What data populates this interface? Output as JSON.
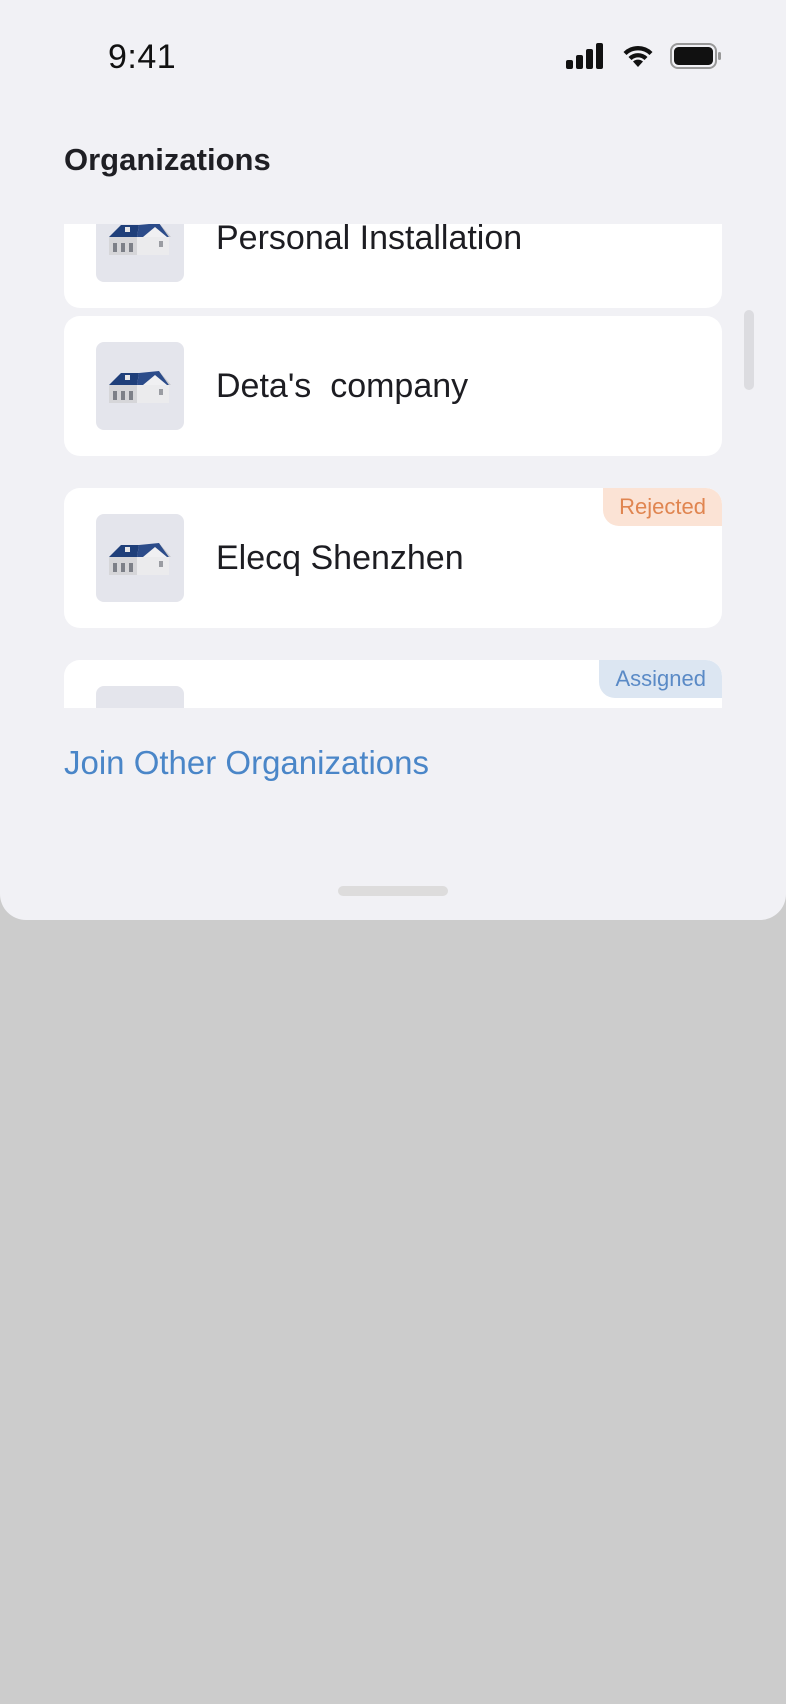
{
  "status_bar": {
    "time": "9:41",
    "icons": [
      "cellular-signal-icon",
      "wifi-icon",
      "battery-icon"
    ]
  },
  "sheet": {
    "title": "Organizations",
    "organizations": [
      {
        "name": "Personal Installation",
        "badge": null,
        "icon": "house-icon"
      },
      {
        "name": "Deta's  company",
        "badge": null,
        "icon": "house-icon"
      },
      {
        "name": "Elecq Shenzhen",
        "badge": "Rejected",
        "icon": "house-icon"
      },
      {
        "name": "",
        "badge": "Assigned",
        "icon": "house-icon"
      }
    ],
    "join_link": "Join Other Organizations"
  },
  "colors": {
    "sheet_background": "#f1f1f5",
    "backdrop": "#cccccc",
    "card": "#ffffff",
    "link": "#4a86c8",
    "rejected_badge_bg": "#fbe3d5",
    "rejected_badge_text": "#e08550",
    "assigned_badge_bg": "#dce6f2",
    "assigned_badge_text": "#5a8ac6"
  }
}
